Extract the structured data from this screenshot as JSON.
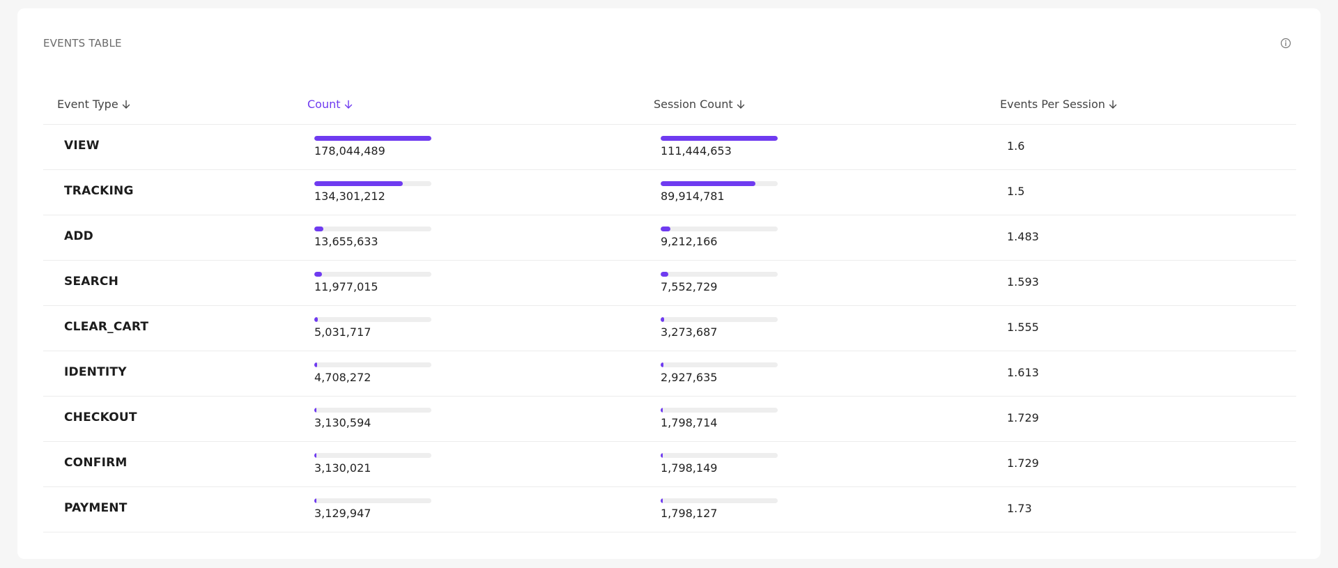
{
  "card": {
    "title": "EVENTS TABLE",
    "info_icon": "info-circle-icon"
  },
  "colors": {
    "accent": "#6f3bf0",
    "track": "#eeeeee"
  },
  "table": {
    "columns": [
      {
        "label": "Event Type",
        "sorted": false
      },
      {
        "label": "Count",
        "sorted": true
      },
      {
        "label": "Session Count",
        "sorted": false
      },
      {
        "label": "Events Per Session",
        "sorted": false
      }
    ],
    "max_count": 178044489,
    "max_session_count": 111444653,
    "rows": [
      {
        "event_type": "VIEW",
        "count": "178,044,489",
        "count_value": 178044489,
        "session_count": "111,444,653",
        "session_value": 111444653,
        "eps": "1.6"
      },
      {
        "event_type": "TRACKING",
        "count": "134,301,212",
        "count_value": 134301212,
        "session_count": "89,914,781",
        "session_value": 89914781,
        "eps": "1.5"
      },
      {
        "event_type": "ADD",
        "count": "13,655,633",
        "count_value": 13655633,
        "session_count": "9,212,166",
        "session_value": 9212166,
        "eps": "1.483"
      },
      {
        "event_type": "SEARCH",
        "count": "11,977,015",
        "count_value": 11977015,
        "session_count": "7,552,729",
        "session_value": 7552729,
        "eps": "1.593"
      },
      {
        "event_type": "CLEAR_CART",
        "count": "5,031,717",
        "count_value": 5031717,
        "session_count": "3,273,687",
        "session_value": 3273687,
        "eps": "1.555"
      },
      {
        "event_type": "IDENTITY",
        "count": "4,708,272",
        "count_value": 4708272,
        "session_count": "2,927,635",
        "session_value": 2927635,
        "eps": "1.613"
      },
      {
        "event_type": "CHECKOUT",
        "count": "3,130,594",
        "count_value": 3130594,
        "session_count": "1,798,714",
        "session_value": 1798714,
        "eps": "1.729"
      },
      {
        "event_type": "CONFIRM",
        "count": "3,130,021",
        "count_value": 3130021,
        "session_count": "1,798,149",
        "session_value": 1798149,
        "eps": "1.729"
      },
      {
        "event_type": "PAYMENT",
        "count": "3,129,947",
        "count_value": 3129947,
        "session_count": "1,798,127",
        "session_value": 1798127,
        "eps": "1.73"
      }
    ]
  }
}
